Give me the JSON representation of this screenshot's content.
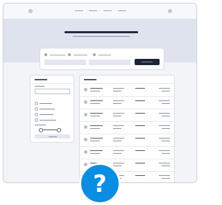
{
  "window": {
    "nav_items": [
      "",
      "",
      "",
      ""
    ]
  },
  "search_card": {
    "fields": [
      "",
      ""
    ],
    "button_label": ""
  },
  "filter_panel": {
    "options": [
      "",
      "",
      "",
      ""
    ]
  },
  "results_table": {
    "rows": 8
  },
  "help_badge": {
    "glyph": "?",
    "icon": "question-mark-icon",
    "color": "#0b8de1"
  },
  "colors": {
    "background": "#f3f4f8",
    "hero": "#dfe3ee",
    "primary_button": "#1c2536",
    "accent": "#0b8de1"
  }
}
